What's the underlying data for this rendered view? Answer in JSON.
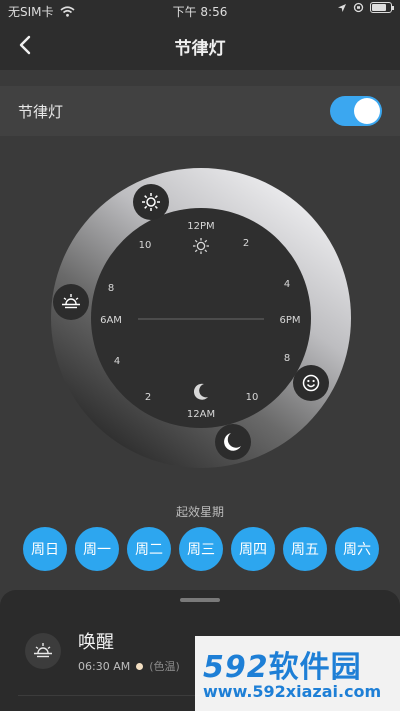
{
  "status_bar": {
    "carrier": "无SIM卡",
    "time": "下午 8:56",
    "battery_level": 0.8
  },
  "nav": {
    "title": "节律灯",
    "back_icon": "chevron-left-icon"
  },
  "toggle_row": {
    "label": "节律灯",
    "enabled": true,
    "accent": "#3ba7f0"
  },
  "dial": {
    "hour_labels": {
      "top": "12PM",
      "bottom": "12AM",
      "left": "6AM",
      "right": "6PM",
      "n2_top": "2",
      "n4_right": "4",
      "n8_right": "8",
      "n10_bottom": "10",
      "n2_bottom": "2",
      "n4_left": "4",
      "n8_left": "8",
      "n10_top": "10"
    },
    "handles": [
      {
        "name": "sun",
        "icon": "sun-icon"
      },
      {
        "name": "sunrise",
        "icon": "sunrise-icon"
      },
      {
        "name": "smile",
        "icon": "smile-icon"
      },
      {
        "name": "moon",
        "icon": "moon-icon"
      }
    ]
  },
  "week": {
    "label": "起效星期",
    "days": [
      "周日",
      "周一",
      "周二",
      "周三",
      "周四",
      "周五",
      "周六"
    ],
    "color": "#2da6ef"
  },
  "sheet": {
    "item": {
      "icon": "sunrise-icon",
      "title": "唤醒",
      "time": "06:30 AM",
      "color_temp_label": "(色温)"
    }
  },
  "watermark": {
    "brand_digits": "592",
    "brand_text": "软件园",
    "url": "www.592xiazai.com"
  }
}
